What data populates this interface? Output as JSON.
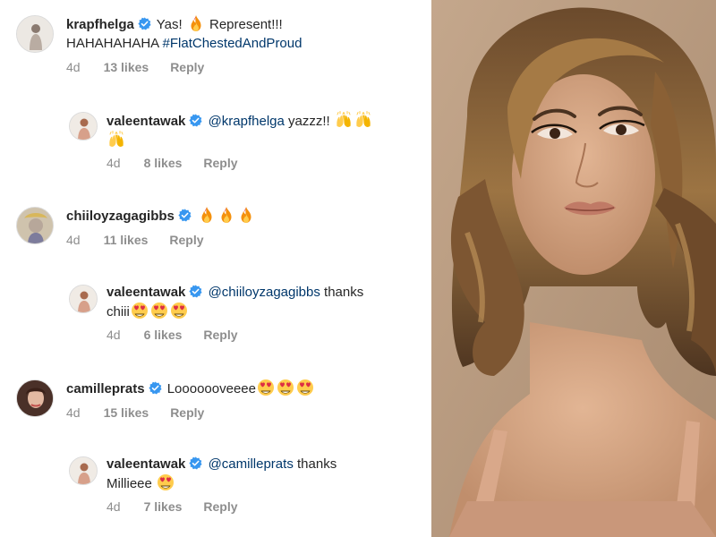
{
  "comments": [
    {
      "username": "krapfhelga",
      "text_pre": "Yas! ",
      "text_post": " Represent!!!",
      "text_line2": "HAHAHAHAHA ",
      "hashtag": "#FlatChestedAndProud",
      "time": "4d",
      "likes": "13 likes",
      "reply": "Reply"
    },
    {
      "username": "valeentawak",
      "mention": "@krapfhelga",
      "text": " yazzz!! ",
      "time": "4d",
      "likes": "8 likes",
      "reply": "Reply"
    },
    {
      "username": "chiiloyzagagibbs",
      "time": "4d",
      "likes": "11 likes",
      "reply": "Reply"
    },
    {
      "username": "valeentawak",
      "mention": "@chiiloyzagagibbs",
      "text": " thanks",
      "text_line2": "chiii",
      "time": "4d",
      "likes": "6 likes",
      "reply": "Reply"
    },
    {
      "username": "camilleprats",
      "text": "Looooooveeee",
      "time": "4d",
      "likes": "15 likes",
      "reply": "Reply"
    },
    {
      "username": "valeentawak",
      "mention": "@camilleprats",
      "text": " thanks",
      "text_line2": "Millieee ",
      "time": "4d",
      "likes": "7 likes",
      "reply": "Reply"
    }
  ],
  "icons": {
    "verified": "verified-badge-icon",
    "fire": "fire-emoji",
    "raised_hands": "raised-hands-emoji",
    "heart_eyes": "heart-eyes-emoji"
  },
  "colors": {
    "verified_blue": "#3897f0",
    "link_blue": "#00376b",
    "meta_gray": "#8e8e8e",
    "text": "#262626"
  }
}
